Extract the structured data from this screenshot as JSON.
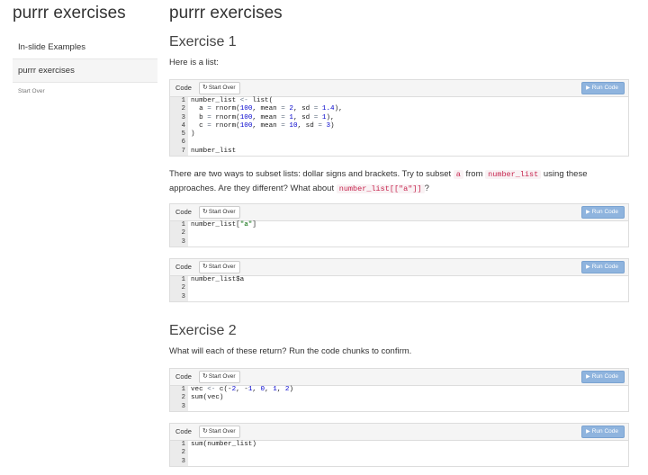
{
  "sidebar": {
    "title": "purrr exercises",
    "items": [
      {
        "label": "In-slide Examples",
        "active": false
      },
      {
        "label": "purrr exercises",
        "active": true
      }
    ],
    "start_over": "Start Over"
  },
  "main": {
    "title": "purrr exercises",
    "exercise1": {
      "title": "Exercise 1",
      "intro": "Here is a list:",
      "question_parts": [
        "There are two ways to subset lists: dollar signs and brackets. Try to subset ",
        "a",
        " from ",
        "number_list",
        " using these approaches. Are they different? What about ",
        "number_list[[\"a\"]]",
        "?"
      ]
    },
    "exercise2": {
      "title": "Exercise 2",
      "intro": "What will each of these return? Run the code chunks to confirm."
    }
  },
  "chunk_ui": {
    "code_label": "Code",
    "start_over": "Start Over",
    "run_code": "Run Code",
    "refresh_icon": "refresh-icon",
    "play_icon": "play-icon"
  },
  "chunks": [
    {
      "lines": [
        "number_list <- list(",
        "  a = rnorm(100, mean = 2, sd = 1.4),",
        "  b = rnorm(100, mean = 1, sd = 1),",
        "  c = rnorm(100, mean = 10, sd = 3)",
        ")",
        "",
        "number_list"
      ]
    },
    {
      "lines": [
        "number_list[\"a\"]",
        "",
        ""
      ]
    },
    {
      "lines": [
        "number_list$a",
        "",
        ""
      ]
    },
    {
      "lines": [
        "vec <- c(-2, -1, 0, 1, 2)",
        "sum(vec)",
        ""
      ]
    },
    {
      "lines": [
        "sum(number_list)",
        "",
        ""
      ]
    }
  ]
}
